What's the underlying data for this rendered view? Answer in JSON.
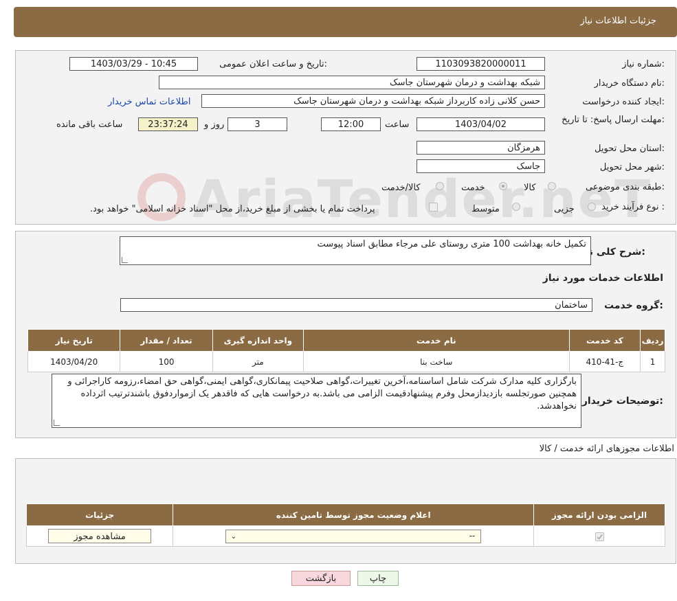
{
  "header": {
    "title": "جزئیات اطلاعات نیاز"
  },
  "form": {
    "need_number_label": "شماره نیاز:",
    "need_number": "1103093820000011",
    "announce_label": "تاریخ و ساعت اعلان عمومی:",
    "announce_value": "1403/03/29 - 10:45",
    "buyer_org_label": "نام دستگاه خریدار:",
    "buyer_org": "شبکه بهداشت و درمان شهرستان جاسک",
    "requester_label": "ایجاد کننده درخواست:",
    "requester": "حسن کلانی زاده کاربرداز شبکه بهداشت و درمان شهرستان جاسک",
    "contact_link": "اطلاعات تماس خریدار",
    "deadline_label": "مهلت ارسال پاسخ: تا تاریخ:",
    "deadline_date": "1403/04/02",
    "time_label": "ساعت",
    "deadline_time": "12:00",
    "days": "3",
    "days_label": "روز و",
    "remaining": "23:37:24",
    "remaining_label": "ساعت باقی مانده",
    "province_label": "استان محل تحویل:",
    "province": "هرمزگان",
    "city_label": "شهر محل تحویل:",
    "city": "جاسک",
    "category_label": "طبقه بندی موضوعی:",
    "category_options": [
      "کالا",
      "خدمت",
      "کالا/خدمت"
    ],
    "process_label": "نوع فرآیند خرید :",
    "process_options": [
      "جزیی",
      "متوسط"
    ],
    "process_note": "پرداخت تمام یا بخشی از مبلغ خرید،از محل \"اسناد خزانه اسلامی\" خواهد بود."
  },
  "watermark": "AriaTender.neT",
  "summary": {
    "label": "شرح کلی نیاز:",
    "text": "تکمیل خانه بهداشت 100 متری روستای علی مرجاء مطابق اسناد پیوست",
    "services_title": "اطلاعات خدمات مورد نیاز",
    "group_label": "گروه خدمت:",
    "group_value": "ساختمان"
  },
  "service_table": {
    "headers": [
      "ردیف",
      "کد خدمت",
      "نام خدمت",
      "واحد اندازه گیری",
      "تعداد / مقدار",
      "تاریخ نیاز"
    ],
    "rows": [
      [
        "1",
        "ج-41-410",
        "ساخت بنا",
        "متر",
        "100",
        "1403/04/20"
      ]
    ]
  },
  "buyer_notes": {
    "label": "توضیحات خریدار:",
    "text": "بارگزاری کلیه مدارک شرکت شامل اساسنامه،آخرین تغییرات،گواهی صلاحیت پیمانکاری،گواهی ایمنی،گواهی حق امضاء،رزومه کاراجرائی و همچنین صورتجلسه بازدیدازمحل وفرم پیشنهادقیمت الزامی می باشد.به درخواست هایی که فاقدهر یک ازمواردفوق باشندترتیب اثرداده نخواهدشد."
  },
  "permits": {
    "title": "اطلاعات مجوزهای ارائه خدمت / کالا",
    "headers": [
      "الزامی بودن ارائه مجوز",
      "اعلام وضعیت مجوز توسط تامین کننده",
      "جزئیات"
    ],
    "select_value": "--",
    "view_button": "مشاهده مجوز"
  },
  "footer": {
    "print": "چاپ",
    "back": "بازگشت"
  },
  "colors": {
    "header_brown": "#8a6b43",
    "link_blue": "#1a45a8",
    "back_pink": "#f8d8dc",
    "print_green": "#eef8e8"
  }
}
